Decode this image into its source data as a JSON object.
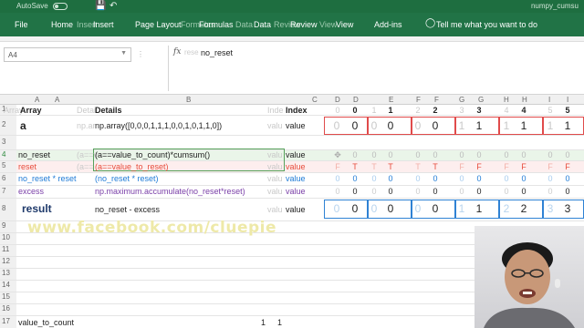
{
  "titlebar": {
    "autosave": "AutoSave",
    "toggle": "Off",
    "doc_name": "numpy_cumsu"
  },
  "ribbon": {
    "tabs": [
      "File",
      "Home",
      "Insert",
      "Insert",
      "Page Layout",
      "Formulas",
      "Formulas",
      "Data",
      "Data",
      "Review",
      "Review",
      "View",
      "View",
      "Add-ins"
    ],
    "tell_me": "Tell me what you want to do"
  },
  "formula_bar": {
    "name_box": "A4",
    "ghost": "rese",
    "formula": "no_reset"
  },
  "columns": [
    "A",
    "A",
    "B",
    "C",
    "D",
    "D",
    "E",
    "F",
    "F",
    "G",
    "G",
    "H",
    "H",
    "I",
    "I"
  ],
  "rows": [
    "1",
    "2",
    "3",
    "4",
    "5",
    "6",
    "7",
    "8",
    "9",
    "10",
    "11",
    "12",
    "13",
    "14",
    "15",
    "16",
    "17"
  ],
  "sheet": {
    "header": {
      "array": "Array",
      "details": "Details",
      "index": "Index",
      "indices": [
        "0",
        "0",
        "1",
        "1",
        "2",
        "2",
        "3",
        "3",
        "4",
        "4",
        "5",
        "5"
      ]
    },
    "ghost_header": {
      "array": "Array",
      "details": "Detai",
      "index": "Inde"
    },
    "a_row": {
      "name": "a",
      "details": "np.array([0,0,0,1,1,1,0,0,1,0,1,1,0])",
      "label": "value",
      "ghost_values": [
        "0",
        "0",
        "0",
        "1",
        "1",
        "1"
      ],
      "values": [
        "0",
        "0",
        "0",
        "1",
        "1",
        "1"
      ]
    },
    "no_reset": {
      "name": "no_reset",
      "details": "(a==value_to_count)*cumsum()",
      "ghost": "(a==v",
      "label": "value",
      "values": [
        "0",
        "0",
        "0",
        "0",
        "0",
        "0",
        "0",
        "0",
        "0",
        "0",
        "0",
        "0"
      ]
    },
    "reset": {
      "name": "reset",
      "details": "(a==value_to_reset)",
      "ghost": "(a==",
      "label": "value",
      "values": [
        "F",
        "T",
        "T",
        "T",
        "T",
        "T",
        "F",
        "F",
        "F",
        "F",
        "F",
        "F"
      ]
    },
    "no_reset_reset": {
      "name": "no_reset * reset",
      "details": "(no_reset * reset)",
      "label": "value",
      "values": [
        "0",
        "0",
        "0",
        "0",
        "0",
        "0",
        "0",
        "0",
        "0",
        "0",
        "0",
        "0"
      ]
    },
    "excess": {
      "name": "excess",
      "details": "np.maximum.accumulate(no_reset*reset)",
      "label": "value",
      "values": [
        "0",
        "0",
        "0",
        "0",
        "0",
        "0",
        "0",
        "0",
        "0",
        "0",
        "0",
        "0"
      ]
    },
    "result": {
      "name": "result",
      "details": "no_reset - excess",
      "label": "value",
      "ghost_values": [
        "0",
        "0",
        "0",
        "1",
        "2",
        "3"
      ],
      "values": [
        "0",
        "0",
        "0",
        "1",
        "2",
        "3"
      ]
    },
    "bottom": {
      "label": "value_to_count",
      "v1": "1",
      "v2": "1"
    }
  },
  "watermark": "www.facebook.com/cluepie",
  "colors": {
    "excel_green": "#217346",
    "red_box": "#e04b4b",
    "blue_box": "#2f82d4",
    "blue_text": "#1f7bd6"
  }
}
